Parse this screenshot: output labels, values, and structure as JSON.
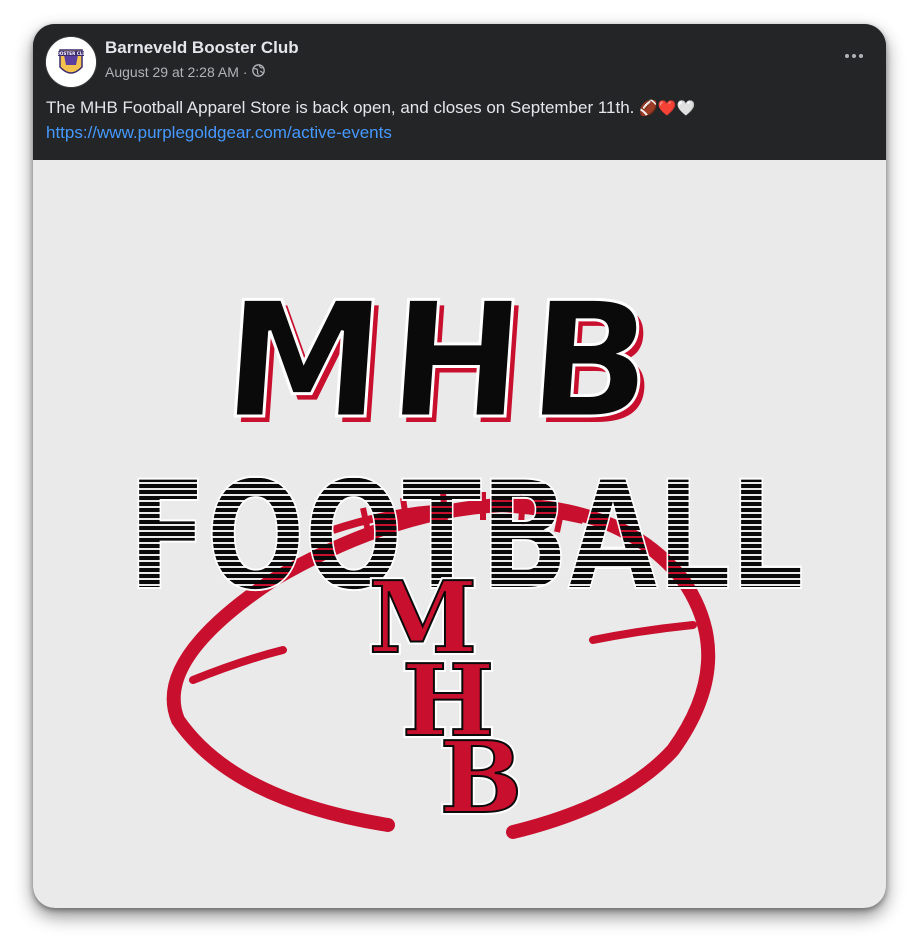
{
  "post": {
    "page_name": "Barneveld Booster Club",
    "timestamp": "August 29 at 2:28 AM",
    "separator": "·",
    "audience_icon": "globe-icon",
    "more_icon": "more-options-icon",
    "text": "The MHB Football Apparel Store is back open, and closes on September 11th.",
    "emojis": "🏈❤️🤍",
    "link": "https://www.purplegoldgear.com/active-events"
  },
  "avatar": {
    "icon": "booster-club-logo",
    "text": "BOOSTER CLUB"
  },
  "image": {
    "line1": "MHB",
    "line2": "FOOTBALL",
    "monogram_m": "M",
    "monogram_h": "H",
    "monogram_b": "B",
    "colors": {
      "red": "#c8102e",
      "black": "#0a0a0a",
      "background": "#eaeaea"
    }
  },
  "colors": {
    "card_bg": "#242526",
    "text_primary": "#e4e6eb",
    "text_secondary": "#b0b3b8",
    "link": "#4599ff"
  }
}
